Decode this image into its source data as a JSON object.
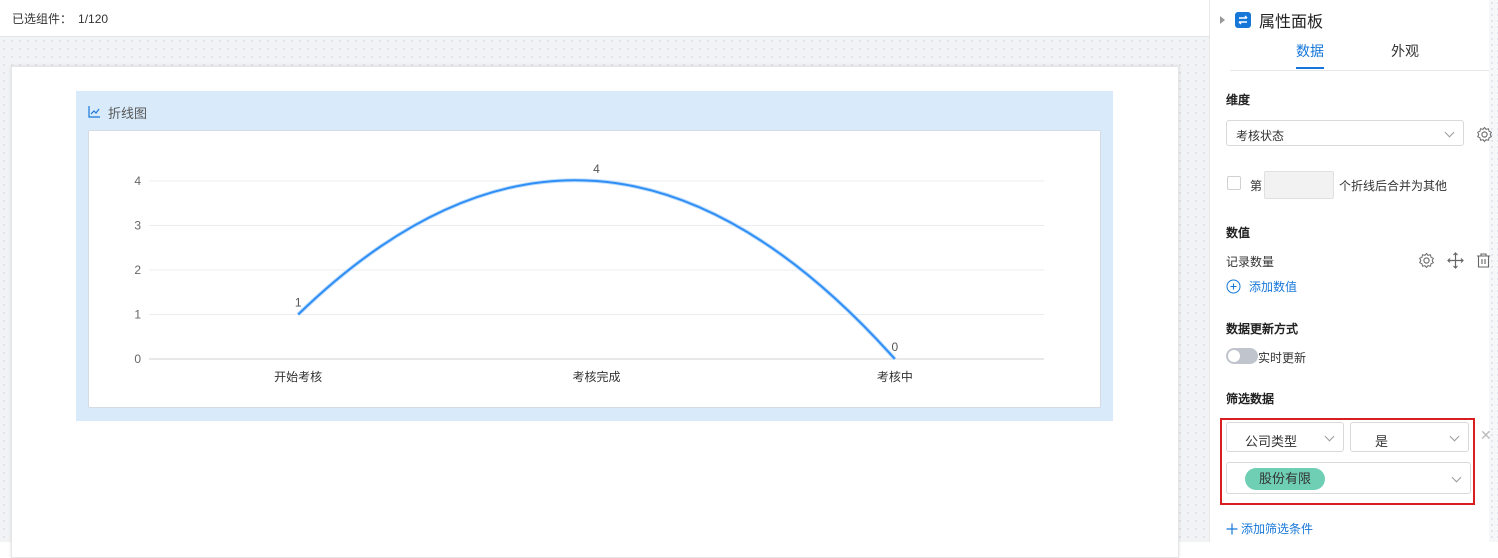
{
  "topbar": {
    "selected_label": "已选组件：",
    "selected_count": "1/120"
  },
  "widget": {
    "title": "折线图",
    "icon": "line-chart-icon"
  },
  "chart_data": {
    "type": "line",
    "smooth": true,
    "categories": [
      "开始考核",
      "考核完成",
      "考核中"
    ],
    "values": [
      1,
      4,
      0
    ],
    "data_labels": [
      "1",
      "4",
      "0"
    ],
    "yticks": [
      "0",
      "1",
      "2",
      "3",
      "4"
    ],
    "ylim": [
      0,
      4
    ],
    "grid": true,
    "legend": false,
    "color": "#2f8ef5"
  },
  "panel": {
    "title": "属性面板",
    "tabs": [
      {
        "label": "数据",
        "active": true
      },
      {
        "label": "外观",
        "active": false
      }
    ],
    "dimension": {
      "label": "维度",
      "value": "考核状态"
    },
    "merge": {
      "prefix": "第",
      "suffix": "个折线后合并为其他",
      "value": ""
    },
    "measure": {
      "label": "数值",
      "field": "记录数量",
      "add": "添加数值"
    },
    "update": {
      "label": "数据更新方式",
      "toggle_label": "实时更新",
      "enabled": false
    },
    "filter": {
      "label": "筛选数据",
      "field": "公司类型",
      "operator": "是",
      "tag": "股份有限",
      "add": "添加筛选条件"
    },
    "accent": "#1677d9",
    "highlight": "#d81e1e"
  }
}
